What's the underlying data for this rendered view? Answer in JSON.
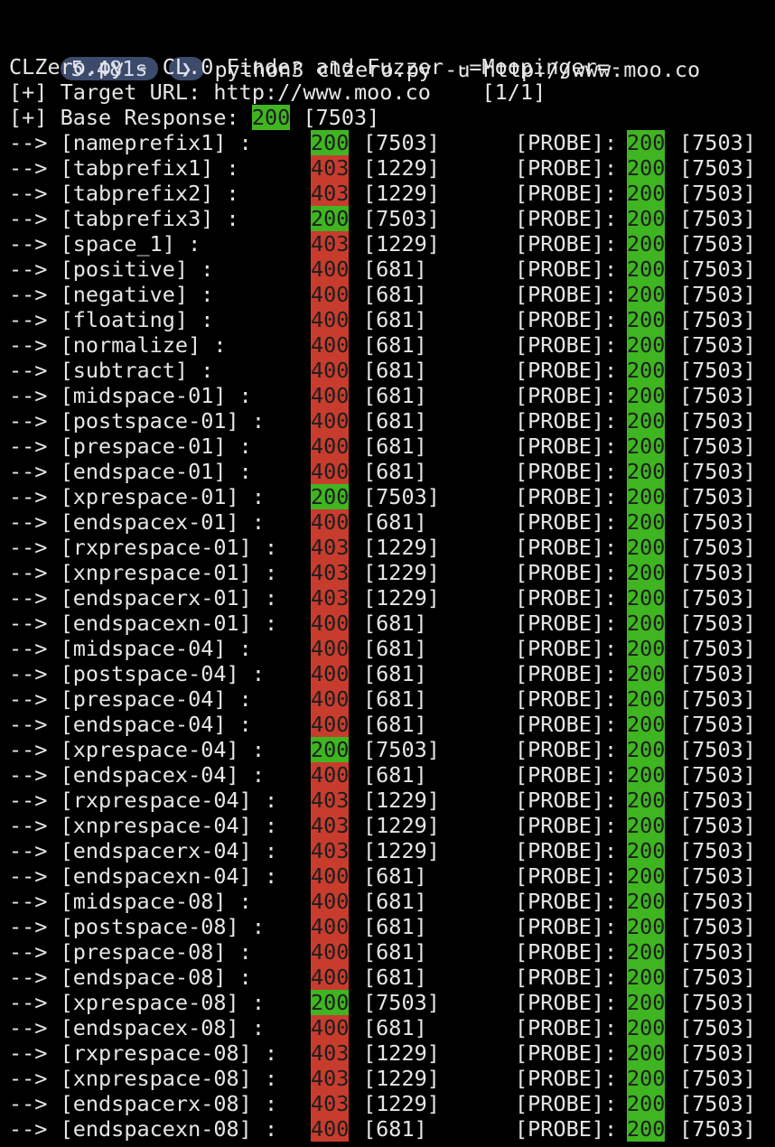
{
  "prompt": {
    "timer": "5.481s",
    "arrow": "❯",
    "command": "python3 clzero.py -u http://www.moo.co"
  },
  "banner": "CLZero.py - CL.0 Finder and Fuzzer -=Moopinger=-",
  "target_line": "[+] Target URL: http://www.moo.co    [1/1]",
  "base_response": {
    "label": "[+] Base Response:",
    "status": "200",
    "length": "[7503]"
  },
  "colors": {
    "background": "#000000",
    "text": "#e6e6e6",
    "ok_green": "#3fb522",
    "error_red": "#c83c2e",
    "pill_bg": "#3c4a6b"
  },
  "rows": [
    {
      "name": "--> [nameprefix1] :",
      "status": "200",
      "len": "[7503]",
      "probe": "[PROBE]:",
      "pstatus": "200",
      "plen": "[7503]"
    },
    {
      "name": "--> [tabprefix1] :",
      "status": "403",
      "len": "[1229]",
      "probe": "[PROBE]:",
      "pstatus": "200",
      "plen": "[7503]"
    },
    {
      "name": "--> [tabprefix2] :",
      "status": "403",
      "len": "[1229]",
      "probe": "[PROBE]:",
      "pstatus": "200",
      "plen": "[7503]"
    },
    {
      "name": "--> [tabprefix3] :",
      "status": "200",
      "len": "[7503]",
      "probe": "[PROBE]:",
      "pstatus": "200",
      "plen": "[7503]"
    },
    {
      "name": "--> [space_1] :",
      "status": "403",
      "len": "[1229]",
      "probe": "[PROBE]:",
      "pstatus": "200",
      "plen": "[7503]"
    },
    {
      "name": "--> [positive] :",
      "status": "400",
      "len": "[681]",
      "probe": "[PROBE]:",
      "pstatus": "200",
      "plen": "[7503]"
    },
    {
      "name": "--> [negative] :",
      "status": "400",
      "len": "[681]",
      "probe": "[PROBE]:",
      "pstatus": "200",
      "plen": "[7503]"
    },
    {
      "name": "--> [floating] :",
      "status": "400",
      "len": "[681]",
      "probe": "[PROBE]:",
      "pstatus": "200",
      "plen": "[7503]"
    },
    {
      "name": "--> [normalize] :",
      "status": "400",
      "len": "[681]",
      "probe": "[PROBE]:",
      "pstatus": "200",
      "plen": "[7503]"
    },
    {
      "name": "--> [subtract] :",
      "status": "400",
      "len": "[681]",
      "probe": "[PROBE]:",
      "pstatus": "200",
      "plen": "[7503]"
    },
    {
      "name": "--> [midspace-01] :",
      "status": "400",
      "len": "[681]",
      "probe": "[PROBE]:",
      "pstatus": "200",
      "plen": "[7503]"
    },
    {
      "name": "--> [postspace-01] :",
      "status": "400",
      "len": "[681]",
      "probe": "[PROBE]:",
      "pstatus": "200",
      "plen": "[7503]"
    },
    {
      "name": "--> [prespace-01] :",
      "status": "400",
      "len": "[681]",
      "probe": "[PROBE]:",
      "pstatus": "200",
      "plen": "[7503]"
    },
    {
      "name": "--> [endspace-01] :",
      "status": "400",
      "len": "[681]",
      "probe": "[PROBE]:",
      "pstatus": "200",
      "plen": "[7503]"
    },
    {
      "name": "--> [xprespace-01] :",
      "status": "200",
      "len": "[7503]",
      "probe": "[PROBE]:",
      "pstatus": "200",
      "plen": "[7503]"
    },
    {
      "name": "--> [endspacex-01] :",
      "status": "400",
      "len": "[681]",
      "probe": "[PROBE]:",
      "pstatus": "200",
      "plen": "[7503]"
    },
    {
      "name": "--> [rxprespace-01] :",
      "status": "403",
      "len": "[1229]",
      "probe": "[PROBE]:",
      "pstatus": "200",
      "plen": "[7503]"
    },
    {
      "name": "--> [xnprespace-01] :",
      "status": "403",
      "len": "[1229]",
      "probe": "[PROBE]:",
      "pstatus": "200",
      "plen": "[7503]"
    },
    {
      "name": "--> [endspacerx-01] :",
      "status": "403",
      "len": "[1229]",
      "probe": "[PROBE]:",
      "pstatus": "200",
      "plen": "[7503]"
    },
    {
      "name": "--> [endspacexn-01] :",
      "status": "400",
      "len": "[681]",
      "probe": "[PROBE]:",
      "pstatus": "200",
      "plen": "[7503]"
    },
    {
      "name": "--> [midspace-04] :",
      "status": "400",
      "len": "[681]",
      "probe": "[PROBE]:",
      "pstatus": "200",
      "plen": "[7503]"
    },
    {
      "name": "--> [postspace-04] :",
      "status": "400",
      "len": "[681]",
      "probe": "[PROBE]:",
      "pstatus": "200",
      "plen": "[7503]"
    },
    {
      "name": "--> [prespace-04] :",
      "status": "400",
      "len": "[681]",
      "probe": "[PROBE]:",
      "pstatus": "200",
      "plen": "[7503]"
    },
    {
      "name": "--> [endspace-04] :",
      "status": "400",
      "len": "[681]",
      "probe": "[PROBE]:",
      "pstatus": "200",
      "plen": "[7503]"
    },
    {
      "name": "--> [xprespace-04] :",
      "status": "200",
      "len": "[7503]",
      "probe": "[PROBE]:",
      "pstatus": "200",
      "plen": "[7503]"
    },
    {
      "name": "--> [endspacex-04] :",
      "status": "400",
      "len": "[681]",
      "probe": "[PROBE]:",
      "pstatus": "200",
      "plen": "[7503]"
    },
    {
      "name": "--> [rxprespace-04] :",
      "status": "403",
      "len": "[1229]",
      "probe": "[PROBE]:",
      "pstatus": "200",
      "plen": "[7503]"
    },
    {
      "name": "--> [xnprespace-04] :",
      "status": "403",
      "len": "[1229]",
      "probe": "[PROBE]:",
      "pstatus": "200",
      "plen": "[7503]"
    },
    {
      "name": "--> [endspacerx-04] :",
      "status": "403",
      "len": "[1229]",
      "probe": "[PROBE]:",
      "pstatus": "200",
      "plen": "[7503]"
    },
    {
      "name": "--> [endspacexn-04] :",
      "status": "400",
      "len": "[681]",
      "probe": "[PROBE]:",
      "pstatus": "200",
      "plen": "[7503]"
    },
    {
      "name": "--> [midspace-08] :",
      "status": "400",
      "len": "[681]",
      "probe": "[PROBE]:",
      "pstatus": "200",
      "plen": "[7503]"
    },
    {
      "name": "--> [postspace-08] :",
      "status": "400",
      "len": "[681]",
      "probe": "[PROBE]:",
      "pstatus": "200",
      "plen": "[7503]"
    },
    {
      "name": "--> [prespace-08] :",
      "status": "400",
      "len": "[681]",
      "probe": "[PROBE]:",
      "pstatus": "200",
      "plen": "[7503]"
    },
    {
      "name": "--> [endspace-08] :",
      "status": "400",
      "len": "[681]",
      "probe": "[PROBE]:",
      "pstatus": "200",
      "plen": "[7503]"
    },
    {
      "name": "--> [xprespace-08] :",
      "status": "200",
      "len": "[7503]",
      "probe": "[PROBE]:",
      "pstatus": "200",
      "plen": "[7503]"
    },
    {
      "name": "--> [endspacex-08] :",
      "status": "400",
      "len": "[681]",
      "probe": "[PROBE]:",
      "pstatus": "200",
      "plen": "[7503]"
    },
    {
      "name": "--> [rxprespace-08] :",
      "status": "403",
      "len": "[1229]",
      "probe": "[PROBE]:",
      "pstatus": "200",
      "plen": "[7503]"
    },
    {
      "name": "--> [xnprespace-08] :",
      "status": "403",
      "len": "[1229]",
      "probe": "[PROBE]:",
      "pstatus": "200",
      "plen": "[7503]"
    },
    {
      "name": "--> [endspacerx-08] :",
      "status": "403",
      "len": "[1229]",
      "probe": "[PROBE]:",
      "pstatus": "200",
      "plen": "[7503]"
    },
    {
      "name": "--> [endspacexn-08] :",
      "status": "400",
      "len": "[681]",
      "probe": "[PROBE]:",
      "pstatus": "200",
      "plen": "[7503]"
    }
  ]
}
